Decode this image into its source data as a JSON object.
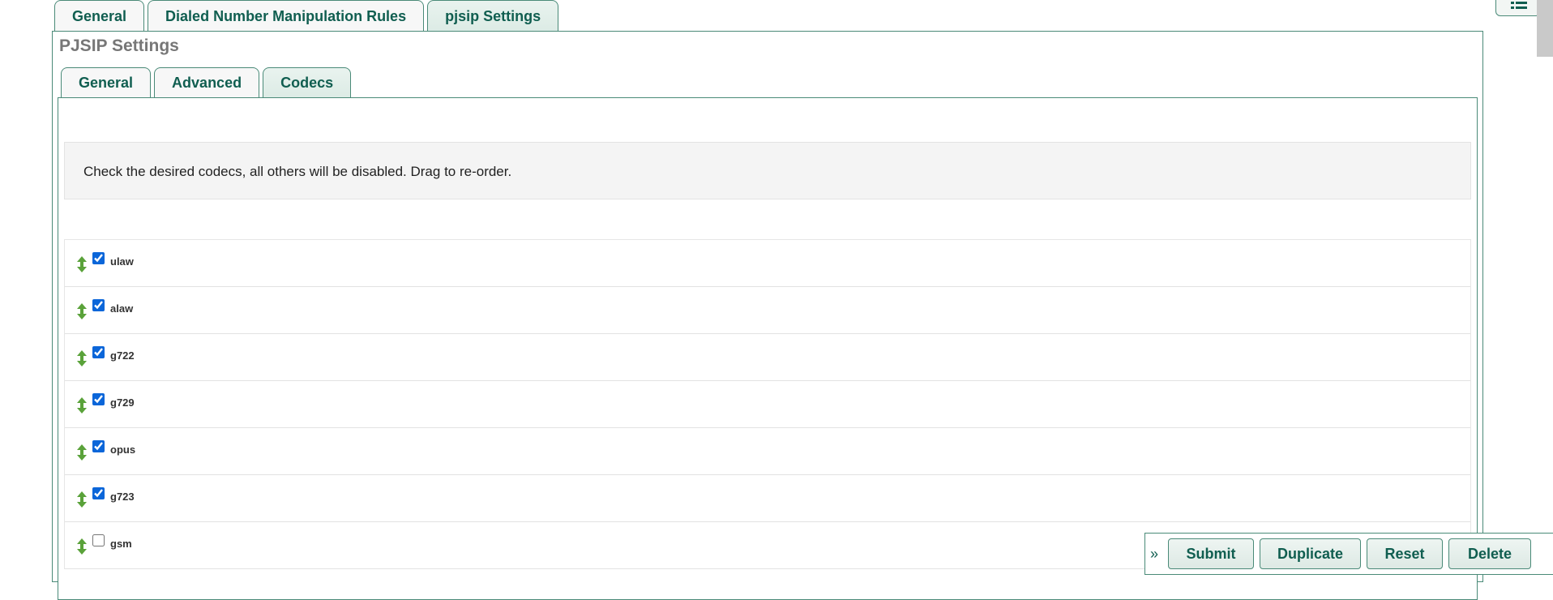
{
  "outer_tabs": [
    {
      "label": "General"
    },
    {
      "label": "Dialed Number Manipulation Rules"
    },
    {
      "label": "pjsip Settings",
      "active": true
    }
  ],
  "panel": {
    "title": "PJSIP Settings"
  },
  "inner_tabs": [
    {
      "label": "General"
    },
    {
      "label": "Advanced"
    },
    {
      "label": "Codecs",
      "active": true
    }
  ],
  "note": "Check the desired codecs, all others will be disabled. Drag to re-order.",
  "codecs": [
    {
      "name": "ulaw",
      "checked": true
    },
    {
      "name": "alaw",
      "checked": true
    },
    {
      "name": "g722",
      "checked": true
    },
    {
      "name": "g729",
      "checked": true
    },
    {
      "name": "opus",
      "checked": true
    },
    {
      "name": "g723",
      "checked": true
    },
    {
      "name": "gsm",
      "checked": false
    }
  ],
  "actions": {
    "collapse_icon": "»",
    "submit": "Submit",
    "duplicate": "Duplicate",
    "reset": "Reset",
    "delete": "Delete"
  },
  "colors": {
    "accent": "#105e50",
    "border": "#4a8a78",
    "drag_arrow": "#5aa23a"
  }
}
